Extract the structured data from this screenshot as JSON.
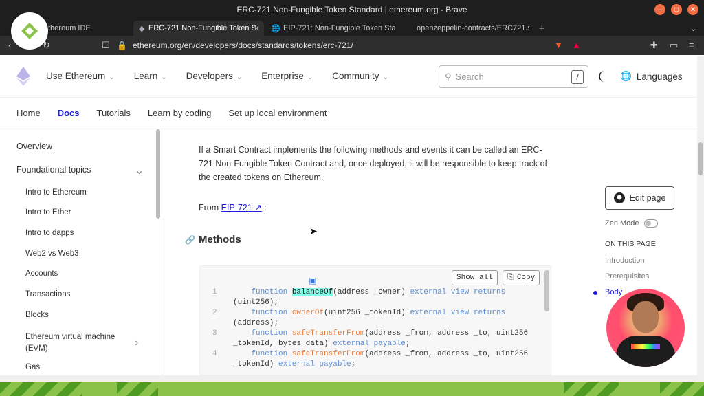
{
  "window": {
    "title": "ERC-721 Non-Fungible Token Standard | ethereum.org - Brave"
  },
  "tabs": [
    {
      "label": "thereum IDE"
    },
    {
      "label": "ERC-721 Non-Fungible Token S"
    },
    {
      "label": "EIP-721: Non-Fungible Token Sta"
    },
    {
      "label": "openzeppelin-contracts/ERC721.s"
    }
  ],
  "address_bar": {
    "url": "ethereum.org/en/developers/docs/standards/tokens/erc-721/"
  },
  "header": {
    "nav": [
      {
        "label": "Use Ethereum"
      },
      {
        "label": "Learn"
      },
      {
        "label": "Developers"
      },
      {
        "label": "Enterprise"
      },
      {
        "label": "Community"
      }
    ],
    "search_placeholder": "Search",
    "search_shortcut": "/",
    "languages": "Languages"
  },
  "subnav": {
    "items": [
      "Home",
      "Docs",
      "Tutorials",
      "Learn by coding",
      "Set up local environment"
    ]
  },
  "sidebar": {
    "overview": "Overview",
    "foundational": "Foundational topics",
    "items": [
      "Intro to Ethereum",
      "Intro to Ether",
      "Intro to dapps",
      "Web2 vs Web3",
      "Accounts",
      "Transactions",
      "Blocks",
      "Ethereum virtual machine (EVM)",
      "Gas"
    ]
  },
  "content": {
    "paragraph": "If a Smart Contract implements the following methods and events it can be called an ERC-721 Non-Fungible Token Contract and, once deployed, it will be responsible to keep track of the created tokens on Ethereum.",
    "from_prefix": "From ",
    "from_link": "EIP-721 ↗",
    "from_suffix": " :",
    "methods_heading": "Methods",
    "show_all": "Show all",
    "copy": "Copy",
    "code": [
      {
        "n": "1",
        "a": "    function ",
        "f": "balanceOf",
        "b": "(address _owner) ",
        "k": "external view returns",
        "c": ""
      },
      {
        "n": "",
        "a": "",
        "f": "",
        "b": "(uint256);",
        "k": "",
        "c": ""
      },
      {
        "n": "2",
        "a": "    function ",
        "f": "ownerOf",
        "b": "(uint256 _tokenId) ",
        "k": "external view returns",
        "c": ""
      },
      {
        "n": "",
        "a": "",
        "f": "",
        "b": "(address);",
        "k": "",
        "c": ""
      },
      {
        "n": "3",
        "a": "    function ",
        "f": "safeTransferFrom",
        "b": "(address _from, address _to, uint256",
        "k": "",
        "c": ""
      },
      {
        "n": "",
        "a": "",
        "f": "",
        "b": "_tokenId, bytes data) ",
        "k": "external payable",
        "c": ";"
      },
      {
        "n": "4",
        "a": "    function ",
        "f": "safeTransferFrom",
        "b": "(address _from, address _to, uint256",
        "k": "",
        "c": ""
      },
      {
        "n": "",
        "a": "",
        "f": "",
        "b": "_tokenId) ",
        "k": "external payable",
        "c": ";"
      }
    ]
  },
  "right": {
    "edit_page": "Edit page",
    "zen_mode": "Zen Mode",
    "on_this_page": "ON THIS PAGE",
    "toc": [
      "Introduction",
      "Prerequisites",
      "Body"
    ]
  }
}
